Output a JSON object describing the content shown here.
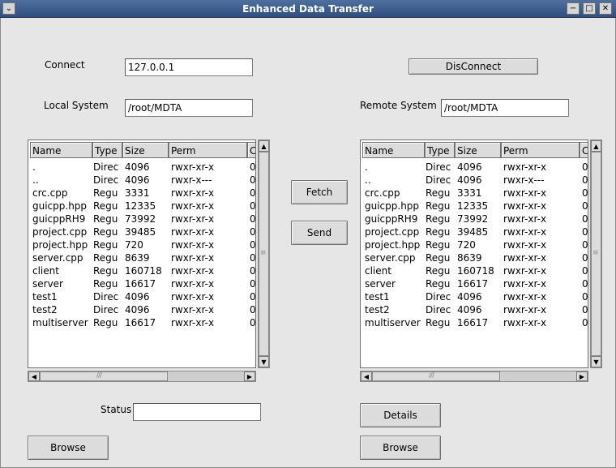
{
  "window": {
    "title": "Enhanced Data Transfer",
    "menu_glyph": "⌄",
    "min_glyph": "−",
    "max_glyph": "□",
    "close_glyph": "✕"
  },
  "connect": {
    "label": "Connect",
    "host_value": "127.0.0.1",
    "disconnect_label": "DisConnect"
  },
  "local": {
    "label": "Local System",
    "path_value": "/root/MDTA",
    "browse_label": "Browse"
  },
  "remote": {
    "label": "Remote System",
    "path_value": "/root/MDTA",
    "browse_label": "Browse",
    "details_label": "Details"
  },
  "actions": {
    "fetch_label": "Fetch",
    "send_label": "Send"
  },
  "status": {
    "label": "Status",
    "value": ""
  },
  "columns": [
    "Name",
    "Type",
    "Size",
    "Perm",
    "C"
  ],
  "local_files": [
    [
      ".",
      "Direc",
      "4096",
      "rwxr-xr-x",
      "0"
    ],
    [
      "..",
      "Direc",
      "4096",
      "rwxr-x---",
      "0"
    ],
    [
      "crc.cpp",
      "Regu",
      "3331",
      "rwxr-xr-x",
      "0"
    ],
    [
      "guicpp.hpp",
      "Regu",
      "12335",
      "rwxr-xr-x",
      "0"
    ],
    [
      "guicppRH9",
      "Regu",
      "73992",
      "rwxr-xr-x",
      "0"
    ],
    [
      "project.cpp",
      "Regu",
      "39485",
      "rwxr-xr-x",
      "0"
    ],
    [
      "project.hpp",
      "Regu",
      "720",
      "rwxr-xr-x",
      "0"
    ],
    [
      "server.cpp",
      "Regu",
      "8639",
      "rwxr-xr-x",
      "0"
    ],
    [
      "client",
      "Regu",
      "160718",
      "rwxr-xr-x",
      "0"
    ],
    [
      "server",
      "Regu",
      "16617",
      "rwxr-xr-x",
      "0"
    ],
    [
      "test1",
      "Direc",
      "4096",
      "rwxr-xr-x",
      "0"
    ],
    [
      "test2",
      "Direc",
      "4096",
      "rwxr-xr-x",
      "0"
    ],
    [
      "multiserver",
      "Regu",
      "16617",
      "rwxr-xr-x",
      "0"
    ]
  ],
  "remote_files": [
    [
      ".",
      "Direc",
      "4096",
      "rwxr-xr-x",
      "0"
    ],
    [
      "..",
      "Direc",
      "4096",
      "rwxr-x---",
      "0"
    ],
    [
      "crc.cpp",
      "Regu",
      "3331",
      "rwxr-xr-x",
      "0"
    ],
    [
      "guicpp.hpp",
      "Regu",
      "12335",
      "rwxr-xr-x",
      "0"
    ],
    [
      "guicppRH9",
      "Regu",
      "73992",
      "rwxr-xr-x",
      "0"
    ],
    [
      "project.cpp",
      "Regu",
      "39485",
      "rwxr-xr-x",
      "0"
    ],
    [
      "project.hpp",
      "Regu",
      "720",
      "rwxr-xr-x",
      "0"
    ],
    [
      "server.cpp",
      "Regu",
      "8639",
      "rwxr-xr-x",
      "0"
    ],
    [
      "client",
      "Regu",
      "160718",
      "rwxr-xr-x",
      "0"
    ],
    [
      "server",
      "Regu",
      "16617",
      "rwxr-xr-x",
      "0"
    ],
    [
      "test1",
      "Direc",
      "4096",
      "rwxr-xr-x",
      "0"
    ],
    [
      "test2",
      "Direc",
      "4096",
      "rwxr-xr-x",
      "0"
    ],
    [
      "multiserver",
      "Regu",
      "16617",
      "rwxr-xr-x",
      "0"
    ]
  ],
  "scroll": {
    "up_glyph": "▲",
    "down_glyph": "▼",
    "left_glyph": "◀",
    "right_glyph": "▶",
    "grip_v": "≡",
    "grip_h": "///"
  }
}
